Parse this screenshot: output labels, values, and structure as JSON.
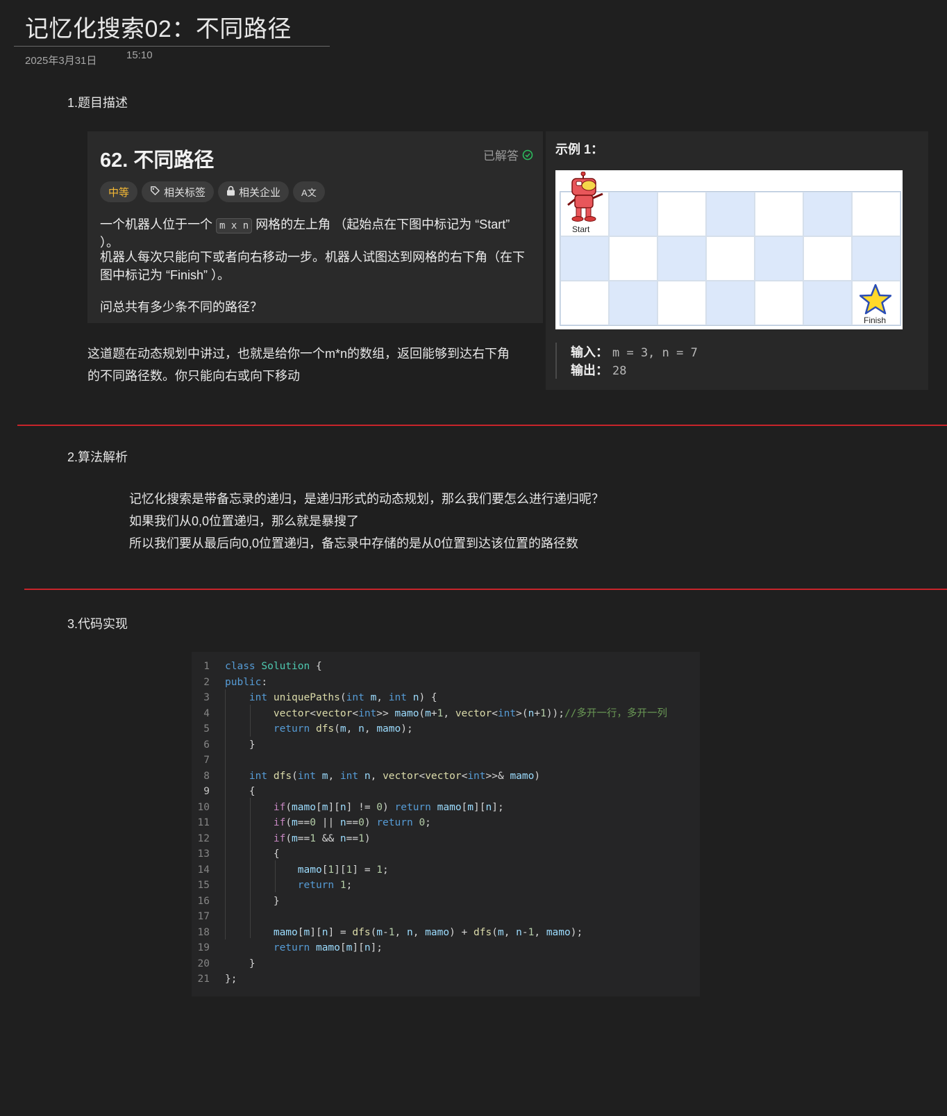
{
  "page": {
    "title": "记忆化搜索02：不同路径",
    "date": "2025年3月31日",
    "time": "15:10"
  },
  "sections": {
    "s1": "1.题目描述",
    "s2": "2.算法解析",
    "s3": "3.代码实现"
  },
  "problem": {
    "title": "62. 不同路径",
    "status": "已解答",
    "tags": {
      "difficulty": "中等",
      "topics": "相关标签",
      "companies": "相关企业",
      "translate": "A文"
    },
    "desc1_pre": "一个机器人位于一个",
    "desc1_code": "m x n",
    "desc1_post": "网格的左上角 （起始点在下图中标记为 “Start” ）。",
    "desc2": "机器人每次只能向下或者向右移动一步。机器人试图达到网格的右下角（在下图中标记为 “Finish” ）。",
    "desc3": "问总共有多少条不同的路径？"
  },
  "example": {
    "label": "示例 1：",
    "start_label": "Start",
    "finish_label": "Finish",
    "input_label": "输入：",
    "input_value": "m = 3, n = 7",
    "output_label": "输出：",
    "output_value": "28",
    "grid_rows": 3,
    "grid_cols": 7
  },
  "note": "这道题在动态规划中讲过，也就是给你一个m*n的数组，返回能够到达右下角的不同路径数。你只能向右或向下移动",
  "algo": {
    "line1": "记忆化搜索是带备忘录的递归，是递归形式的动态规划，那么我们要怎么进行递归呢？",
    "line2": "如果我们从0,0位置递归，那么就是暴搜了",
    "line3": "所以我们要从最后向0,0位置递归，备忘录中存储的是从0位置到达该位置的路径数"
  },
  "code": {
    "current_line": 9,
    "lines": [
      "class Solution {",
      "public:",
      "    int uniquePaths(int m, int n) {",
      "        vector<vector<int>> mamo(m+1, vector<int>(n+1));//多开一行，多开一列",
      "        return dfs(m, n, mamo);",
      "    }",
      "",
      "    int dfs(int m, int n, vector<vector<int>>& mamo)",
      "    {",
      "        if(mamo[m][n] != 0) return mamo[m][n];",
      "        if(m==0 || n==0) return 0;",
      "        if(m==1 && n==1)",
      "        {",
      "            mamo[1][1] = 1;",
      "            return 1;",
      "        }",
      "",
      "        mamo[m][n] = dfs(m-1, n, mamo) + dfs(m, n-1, mamo);",
      "        return mamo[m][n];",
      "    }",
      "};"
    ]
  },
  "colors": {
    "background": "#1f1f1f",
    "card": "#2a2a2a",
    "divider_red": "#c8242a",
    "difficulty_yellow": "#f5b935",
    "solved_green": "#2cbb5d"
  }
}
